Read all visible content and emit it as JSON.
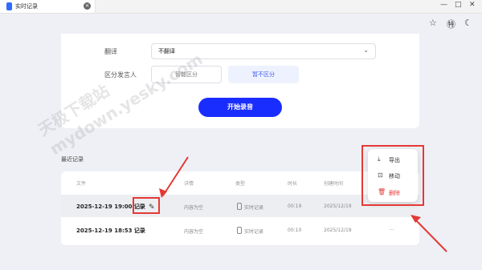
{
  "window": {
    "tab_title": "实时记录",
    "minimize": "—",
    "maximize": "□",
    "close": "✕",
    "tab_close": "×"
  },
  "toolbar": {
    "star": "☆",
    "translate": "㊕",
    "moon": "☾"
  },
  "settings": {
    "translate_label": "翻译",
    "translate_value": "不翻译",
    "speaker_label": "区分发言人",
    "speaker_options": [
      "智能区分",
      "暂不区分"
    ],
    "speaker_selected": "暂不区分",
    "start_button": "开始录音"
  },
  "recent": {
    "title": "最近记录",
    "columns": [
      "文件",
      "详情",
      "类型",
      "时长",
      "创建时间"
    ],
    "rows": [
      {
        "file": "2025-12-19 19:00 记录",
        "detail": "内容为空",
        "type": "实时记录",
        "duration": "00:19",
        "created": "2025/12/19"
      },
      {
        "file": "2025-12-19 18:53 记录",
        "detail": "内容为空",
        "type": "实时记录",
        "duration": "00:10",
        "created": "2025/12/19",
        "more": "···"
      }
    ],
    "row_icons": {
      "star": "☆",
      "edit": "✎"
    }
  },
  "context_menu": {
    "items": [
      {
        "label": "导出",
        "icon": "⤓"
      },
      {
        "label": "移动",
        "icon": "⊡"
      },
      {
        "label": "删除",
        "icon": "🗑"
      }
    ]
  },
  "watermark": {
    "line1": "天极下载站",
    "line2": "mydown.yesky.com"
  },
  "colors": {
    "accent": "#1a2dff",
    "highlight": "#e53935",
    "background": "#eef0f5"
  }
}
